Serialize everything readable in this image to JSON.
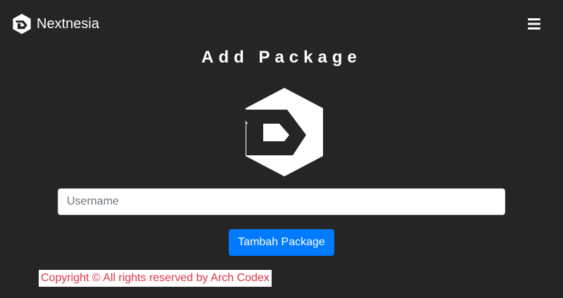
{
  "navbar": {
    "brand": "Nextnesia",
    "logo_icon": "nextnesia-logo-icon",
    "menu_icon": "hamburger-menu-icon"
  },
  "page": {
    "title": "Add Package",
    "logo_icon": "nextnesia-hexagon-logo-icon"
  },
  "form": {
    "username_placeholder": "Username",
    "username_value": "",
    "submit_label": "Tambah Package"
  },
  "footer": {
    "text": "Copyright © All rights reserved by Arch Codex"
  },
  "colors": {
    "background": "#252525",
    "primary": "#007bff",
    "footer_text": "#dc3545"
  }
}
